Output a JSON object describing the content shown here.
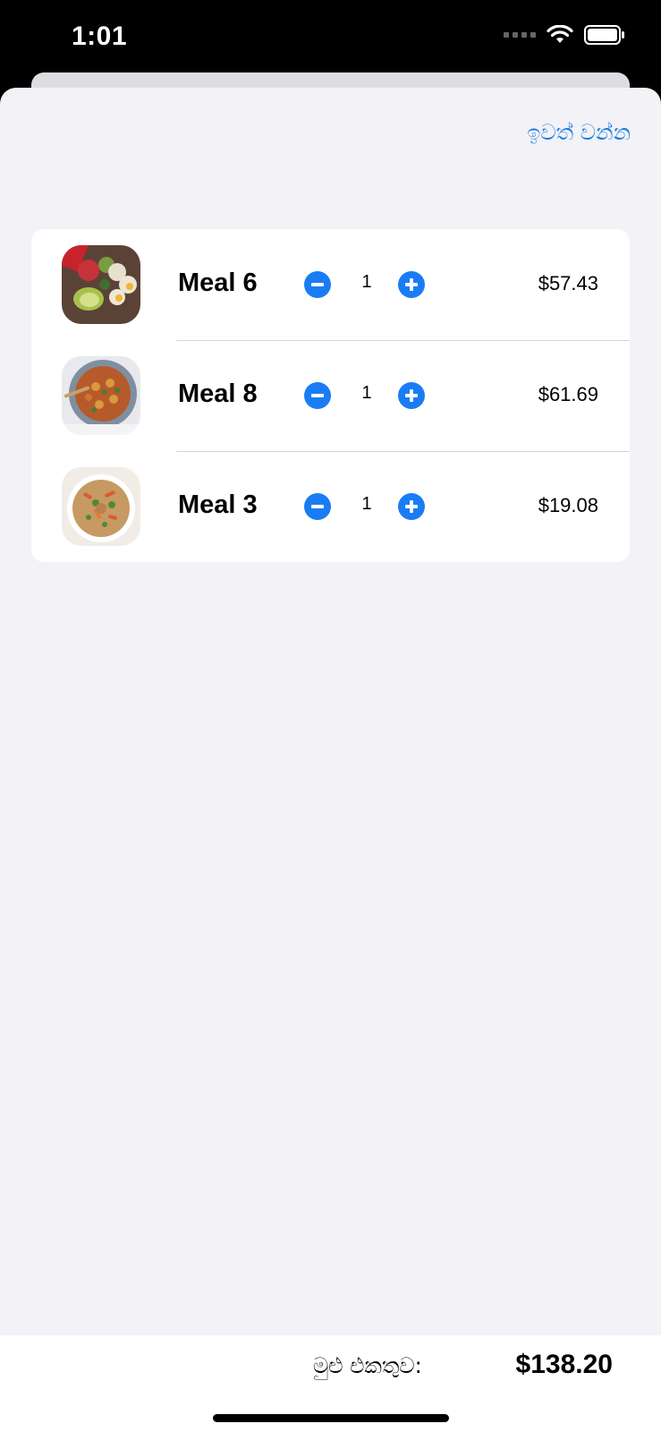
{
  "status_bar": {
    "time": "1:01"
  },
  "header": {
    "dismiss_label": "ඉවත් වන්න"
  },
  "cart": {
    "items": [
      {
        "name": "Meal 6",
        "quantity": "1",
        "price": "$57.43"
      },
      {
        "name": "Meal 8",
        "quantity": "1",
        "price": "$61.69"
      },
      {
        "name": "Meal 3",
        "quantity": "1",
        "price": "$19.08"
      }
    ]
  },
  "footer": {
    "total_label": "මුළු එකතුව:",
    "total_value": "$138.20"
  },
  "colors": {
    "accent": "#1a7cf5",
    "background": "#f2f2f7",
    "card": "#ffffff"
  }
}
